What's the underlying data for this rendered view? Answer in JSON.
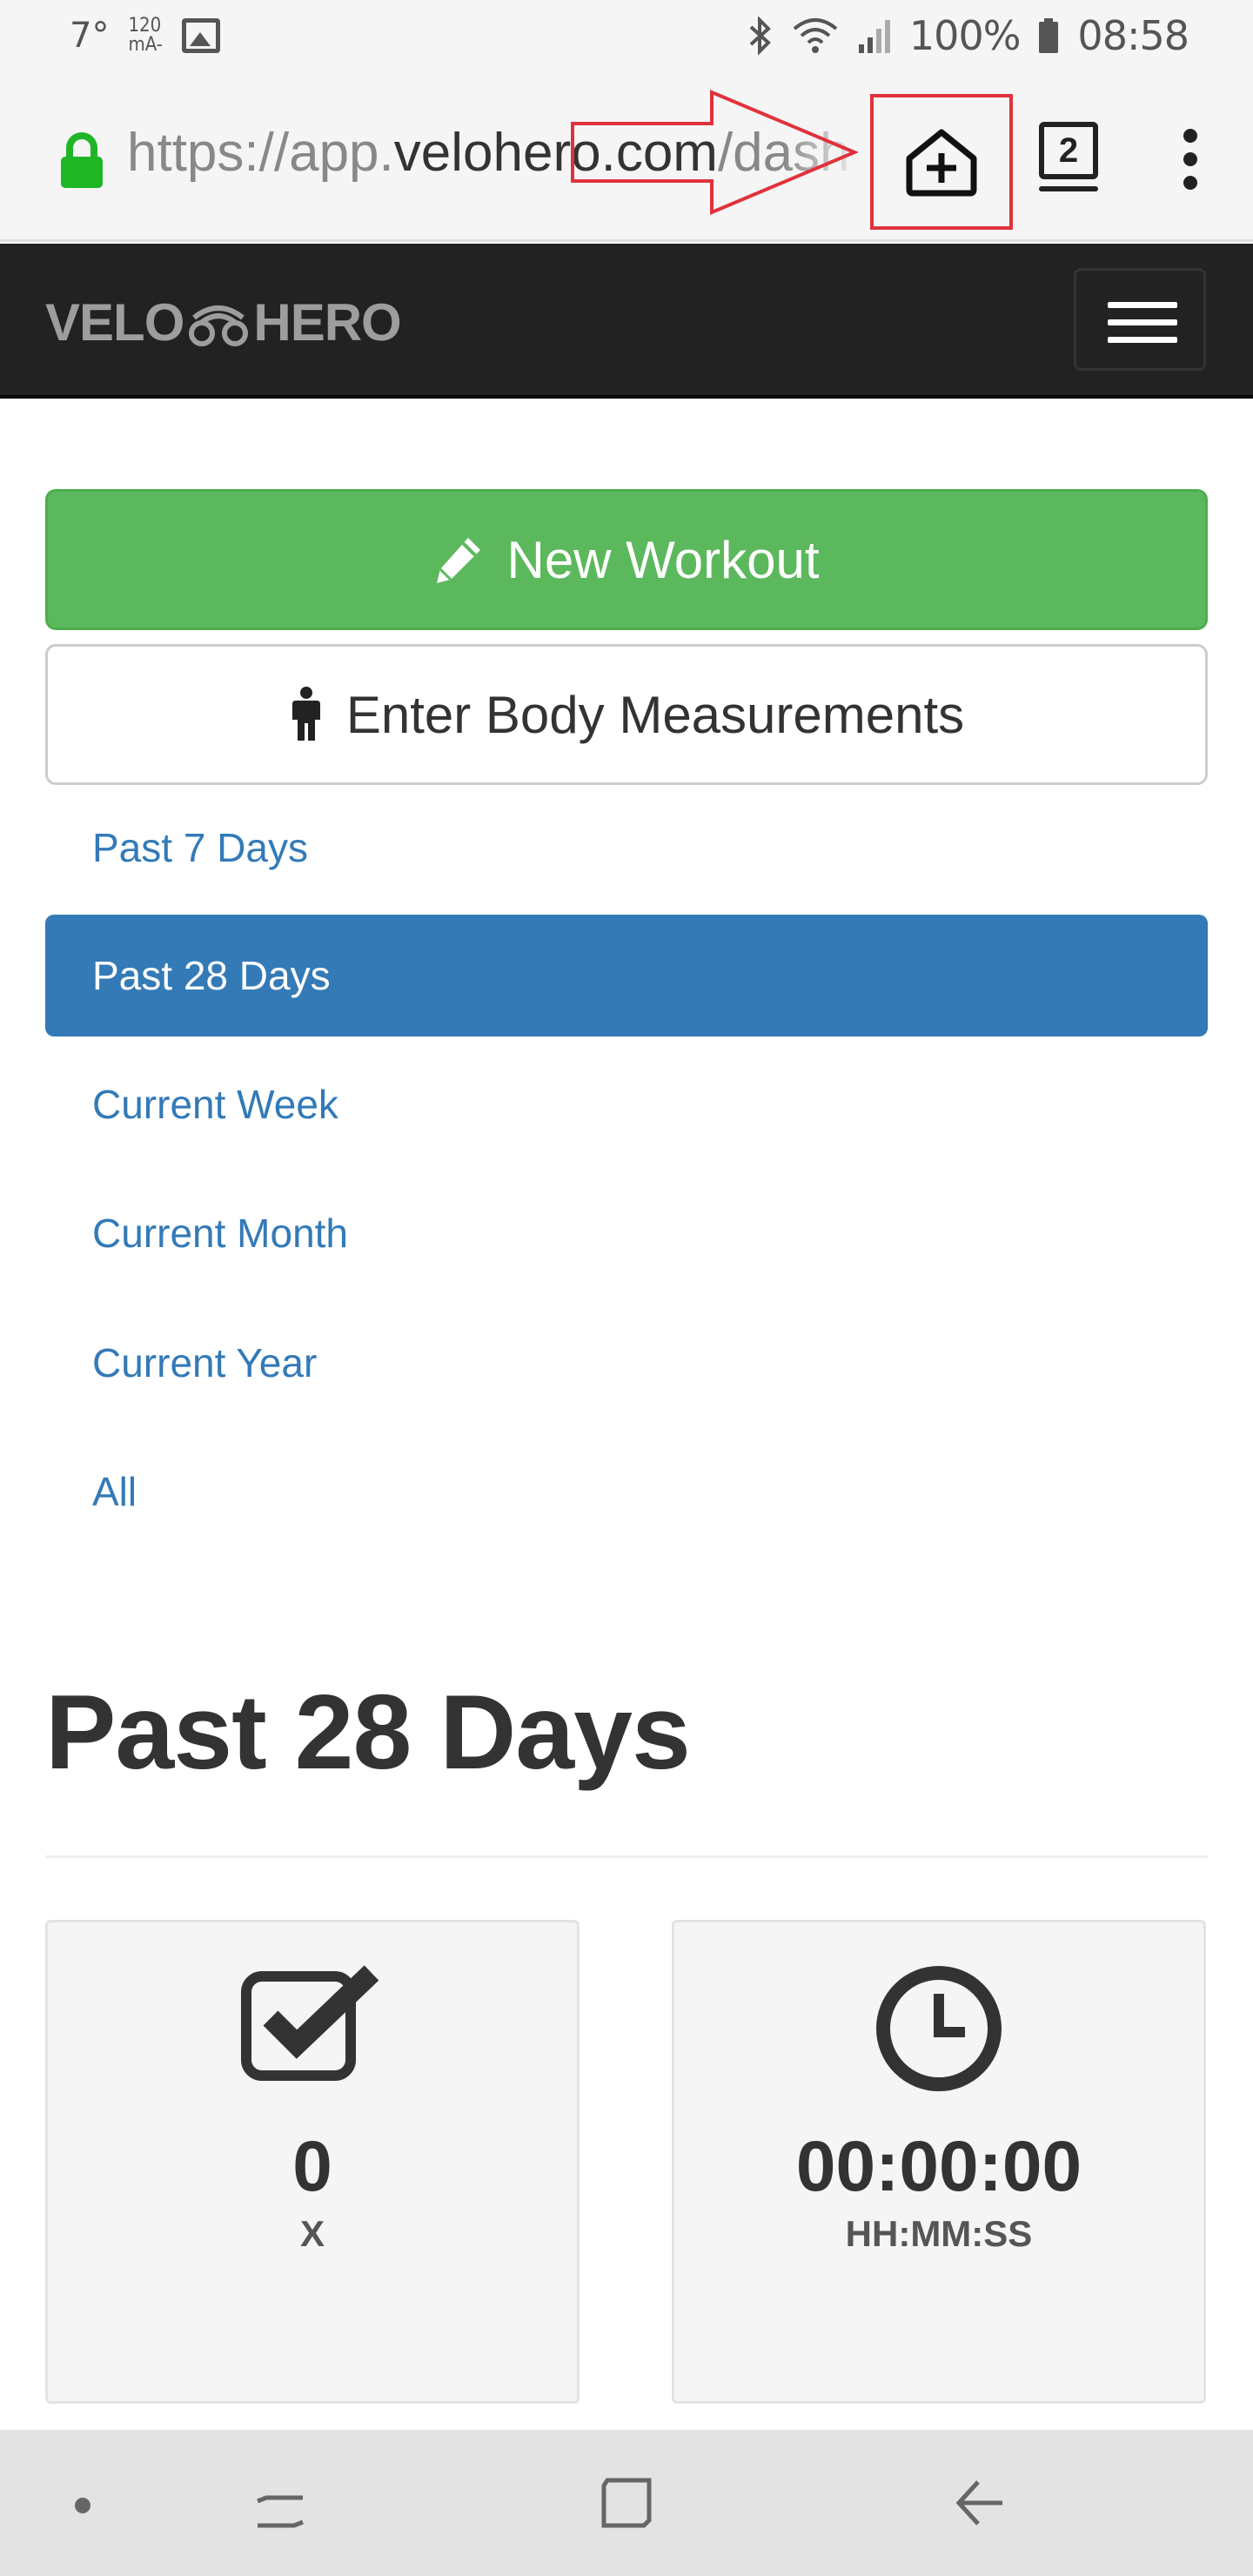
{
  "status_bar": {
    "temperature": "7°",
    "current_top": "120",
    "current_bottom": "mA-",
    "battery": "100%",
    "time": "08:58"
  },
  "address_bar": {
    "url_prefix": "https://app.",
    "url_host": "velohero.com",
    "url_suffix": "/dash",
    "tab_count": "2"
  },
  "navbar": {
    "brand_left": "VELO",
    "brand_right": "HERO"
  },
  "actions": {
    "new_workout": "New Workout",
    "body_measurements": "Enter Body Measurements"
  },
  "periods": [
    {
      "label": "Past 7 Days",
      "active": false
    },
    {
      "label": "Past 28 Days",
      "active": true
    },
    {
      "label": "Current Week",
      "active": false
    },
    {
      "label": "Current Month",
      "active": false
    },
    {
      "label": "Current Year",
      "active": false
    },
    {
      "label": "All",
      "active": false
    }
  ],
  "page_title": "Past 28 Days",
  "stats": [
    {
      "icon": "checkbox-icon",
      "value": "0",
      "unit": "X"
    },
    {
      "icon": "clock-icon",
      "value": "00:00:00",
      "unit": "HH:MM:SS"
    }
  ],
  "colors": {
    "navbar_bg": "#222222",
    "success": "#5cb85c",
    "primary": "#337ab7",
    "annotation": "#e0323c"
  }
}
